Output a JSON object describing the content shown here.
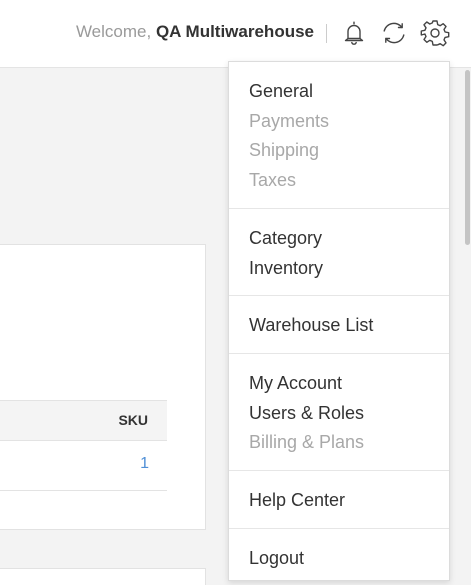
{
  "header": {
    "welcome_prefix": "Welcome,",
    "user_name": "QA Multiwarehouse",
    "icons": [
      "bell-icon",
      "sync-icon",
      "gear-icon"
    ]
  },
  "table": {
    "sku_header": "SKU",
    "rows": [
      {
        "sku": "1"
      }
    ]
  },
  "menu": {
    "groups": [
      {
        "items": [
          {
            "label": "General",
            "enabled": true
          },
          {
            "label": "Payments",
            "enabled": false
          },
          {
            "label": "Shipping",
            "enabled": false
          },
          {
            "label": "Taxes",
            "enabled": false
          }
        ]
      },
      {
        "items": [
          {
            "label": "Category",
            "enabled": true
          },
          {
            "label": "Inventory",
            "enabled": true
          }
        ]
      },
      {
        "items": [
          {
            "label": "Warehouse List",
            "enabled": true
          }
        ]
      },
      {
        "items": [
          {
            "label": "My Account",
            "enabled": true
          },
          {
            "label": "Users & Roles",
            "enabled": true
          },
          {
            "label": "Billing & Plans",
            "enabled": false
          }
        ]
      },
      {
        "items": [
          {
            "label": "Help Center",
            "enabled": true
          }
        ]
      },
      {
        "items": [
          {
            "label": "Logout",
            "enabled": true
          }
        ]
      }
    ]
  },
  "colors": {
    "text": "#333333",
    "muted": "#a8a8a8",
    "link": "#4f8fd6",
    "background": "#f3f3f3"
  }
}
